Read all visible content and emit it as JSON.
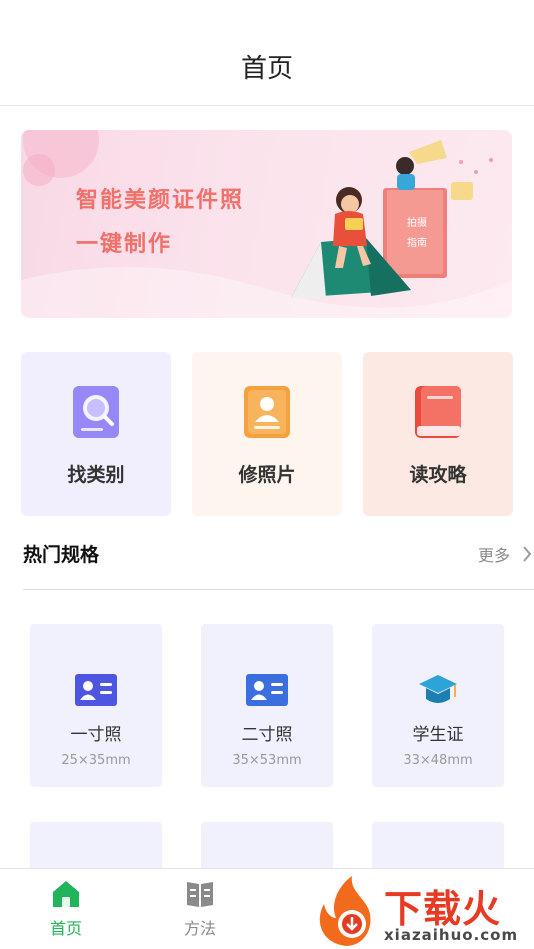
{
  "header": {
    "title": "首页"
  },
  "banner": {
    "line1": "智能美颜证件照",
    "line2": "一键制作",
    "book_tag_1": "拍摄",
    "book_tag_2": "指南"
  },
  "quick_actions": [
    {
      "label": "找类别",
      "icon": "search-doc-icon"
    },
    {
      "label": "修照片",
      "icon": "person-card-icon"
    },
    {
      "label": "读攻略",
      "icon": "book-icon"
    }
  ],
  "hot_specs": {
    "title": "热门规格",
    "more": "更多",
    "items": [
      {
        "name": "一寸照",
        "size": "25×35mm",
        "icon": "id-card-icon"
      },
      {
        "name": "二寸照",
        "size": "35×53mm",
        "icon": "id-card-icon"
      },
      {
        "name": "学生证",
        "size": "33×48mm",
        "icon": "graduation-cap-icon"
      }
    ]
  },
  "tabbar": {
    "items": [
      {
        "label": "首页",
        "icon": "home-icon",
        "active": true
      },
      {
        "label": "方法",
        "icon": "open-book-icon",
        "active": false
      }
    ]
  },
  "watermark": {
    "text": "下载火",
    "url": "xiazaihuo.com"
  },
  "colors": {
    "accent_green": "#22b45a",
    "banner_text": "#f0706a",
    "watermark_red": "#e73a23"
  }
}
